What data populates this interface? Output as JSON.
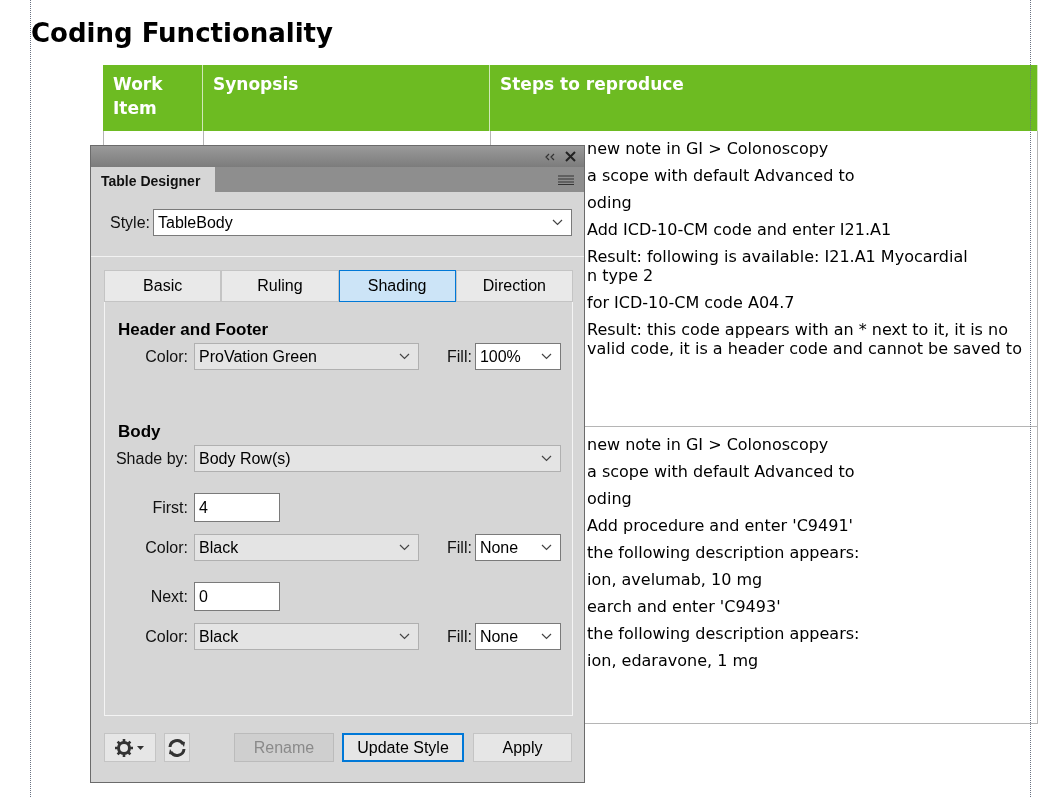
{
  "document": {
    "heading": "Coding Functionality",
    "table": {
      "columns": [
        "Work Item",
        "Synopsis",
        "Steps to reproduce"
      ],
      "rows": [
        {
          "steps": [
            "new note in GI > Colonoscopy",
            "a scope with default Advanced to",
            "oding",
            "Add ICD-10-CM code and enter I21.A1",
            "Result: following is available: I21.A1 Myocardial\nn type 2",
            "for ICD-10-CM code A04.7",
            "Result: this code appears with an * next to it, it is no\nvalid code, it is a header code and cannot be saved to"
          ]
        },
        {
          "steps": [
            "new note in GI > Colonoscopy",
            "a scope with default Advanced to",
            "oding",
            "Add procedure and enter 'C9491'",
            "the following description appears:",
            "ion, avelumab, 10 mg",
            "earch and enter 'C9493'",
            "the following description appears:",
            "ion, edaravone, 1 mg"
          ]
        }
      ]
    }
  },
  "dialog": {
    "panel_tab": "Table Designer",
    "style": {
      "label": "Style:",
      "value": "TableBody"
    },
    "tabs": [
      {
        "label": "Basic",
        "selected": false
      },
      {
        "label": "Ruling",
        "selected": false
      },
      {
        "label": "Shading",
        "selected": true
      },
      {
        "label": "Direction",
        "selected": false
      }
    ],
    "sections": [
      {
        "title": "Header and Footer",
        "rows": [
          {
            "kind": "select_fill",
            "label": "Color:",
            "value": "ProVation Green",
            "fill_label": "Fill:",
            "fill": "100%"
          }
        ]
      },
      {
        "title": "Body",
        "rows": [
          {
            "kind": "select_wide",
            "label": "Shade by:",
            "value": "Body Row(s)"
          },
          {
            "kind": "input",
            "label": "First:",
            "value": "4"
          },
          {
            "kind": "select_fill",
            "label": "Color:",
            "value": "Black",
            "fill_label": "Fill:",
            "fill": "None"
          },
          {
            "kind": "input",
            "label": "Next:",
            "value": "0"
          },
          {
            "kind": "select_fill",
            "label": "Color:",
            "value": "Black",
            "fill_label": "Fill:",
            "fill": "None"
          }
        ]
      }
    ],
    "buttons": [
      {
        "label": "Rename",
        "disabled": true,
        "focused": false
      },
      {
        "label": "Update Style",
        "disabled": false,
        "focused": true
      },
      {
        "label": "Apply",
        "disabled": false,
        "focused": false
      }
    ]
  }
}
